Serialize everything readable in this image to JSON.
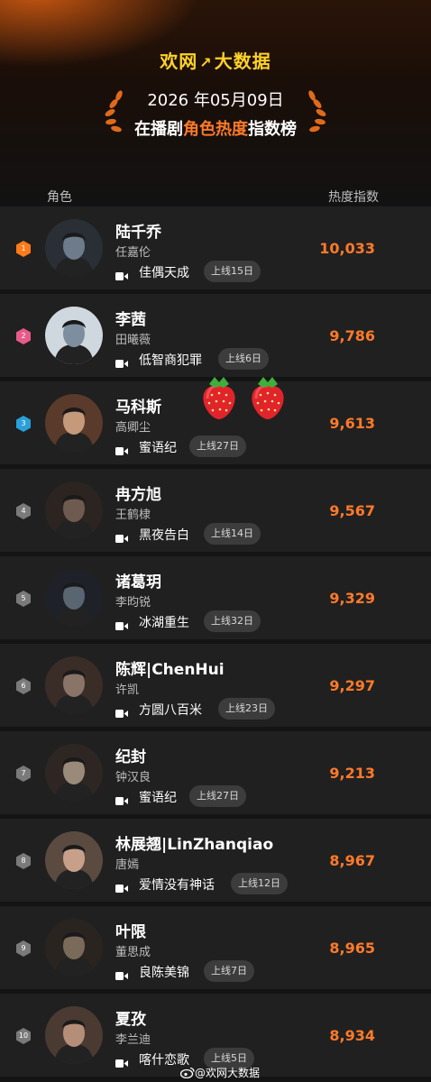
{
  "brand": {
    "left": "欢网",
    "right": "大数据"
  },
  "title": {
    "date": "2026 年05月09日",
    "prefix": "在播剧",
    "highlight": "角色热度",
    "suffix": "指数榜"
  },
  "columns": {
    "left": "角色",
    "right": "热度指数"
  },
  "rank_colors": {
    "1": "#ff7a1a",
    "2": "#e85a8a",
    "3": "#2aa0d8",
    "other": "#7a7a7a"
  },
  "rows": [
    {
      "rank": "1",
      "role": "陆千乔",
      "actor": "任嘉伦",
      "show": "佳偶天成",
      "online": "上线15日",
      "score": "10,033"
    },
    {
      "rank": "2",
      "role": "李茜",
      "actor": "田曦薇",
      "show": "低智商犯罪",
      "online": "上线6日",
      "score": "9,786"
    },
    {
      "rank": "3",
      "role": "马科斯",
      "actor": "高卿尘",
      "show": "蜜语纪",
      "online": "上线27日",
      "score": "9,613"
    },
    {
      "rank": "4",
      "role": "冉方旭",
      "actor": "王鹤棣",
      "show": "黑夜告白",
      "online": "上线14日",
      "score": "9,567"
    },
    {
      "rank": "5",
      "role": "诸葛玥",
      "actor": "李昀锐",
      "show": "冰湖重生",
      "online": "上线32日",
      "score": "9,329"
    },
    {
      "rank": "6",
      "role": "陈辉|ChenHui",
      "actor": "许凯",
      "show": "方圆八百米",
      "online": "上线23日",
      "score": "9,297"
    },
    {
      "rank": "7",
      "role": "纪封",
      "actor": "钟汉良",
      "show": "蜜语纪",
      "online": "上线27日",
      "score": "9,213"
    },
    {
      "rank": "8",
      "role": "林展翘|LinZhanqiao",
      "actor": "唐嫣",
      "show": "爱情没有神话",
      "online": "上线12日",
      "score": "8,967"
    },
    {
      "rank": "9",
      "role": "叶限",
      "actor": "董思成",
      "show": "良陈美锦",
      "online": "上线7日",
      "score": "8,965"
    },
    {
      "rank": "10",
      "role": "夏孜",
      "actor": "李兰迪",
      "show": "喀什恋歌",
      "online": "上线5日",
      "score": "8,934"
    }
  ],
  "watermark": "@欢网大数据",
  "icons": [
    "laurel-icon",
    "video-camera-icon",
    "strawberry-icon",
    "weibo-icon"
  ]
}
